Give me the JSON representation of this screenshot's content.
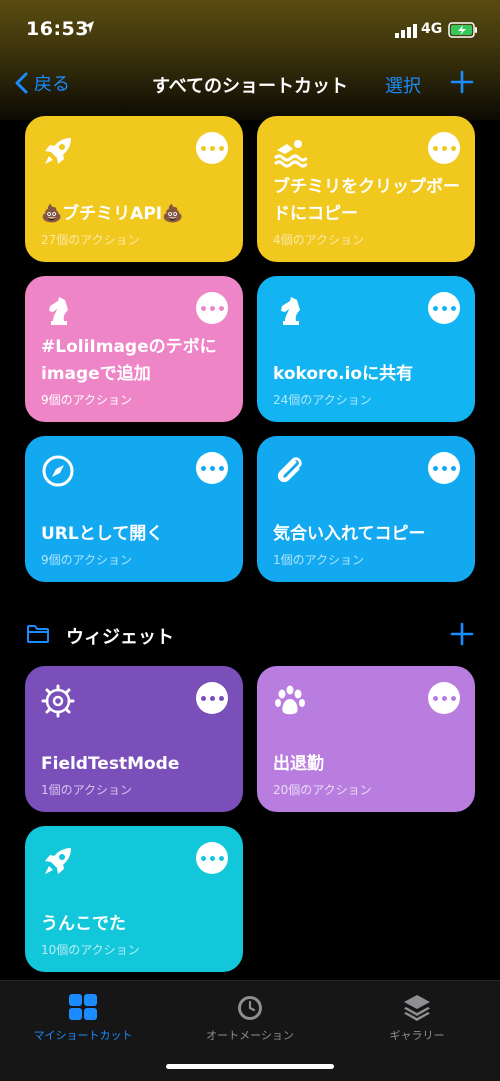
{
  "status_bar": {
    "time": "16:53",
    "network": "4G"
  },
  "nav": {
    "back_label": "戻る",
    "title": "すべてのショートカット",
    "select_label": "選択"
  },
  "cards": [
    {
      "title": "💩ブチミリAPI💩",
      "count": "27個のアクション",
      "color": "#f0c81e",
      "icon": "rocket-icon"
    },
    {
      "title": "ブチミリをクリップボードにコピー",
      "count": "4個のアクション",
      "color": "#f0c81e",
      "icon": "swimmer-icon"
    },
    {
      "title": "#LoliImageのテボにimageで追加",
      "count": "9個のアクション",
      "color": "#ee85c7",
      "icon": "chess-knight-icon"
    },
    {
      "title": "kokoro.ioに共有",
      "count": "24個のアクション",
      "color": "#12b5f2",
      "icon": "chess-knight-icon"
    },
    {
      "title": "URLとして開く",
      "count": "9個のアクション",
      "color": "#12a9f0",
      "icon": "compass-icon"
    },
    {
      "title": "気合い入れてコピー",
      "count": "1個のアクション",
      "color": "#12a9f0",
      "icon": "paperclip-icon"
    }
  ],
  "section": {
    "title": "ウィジェット",
    "icon": "folder-icon"
  },
  "widget_cards": [
    {
      "title": "FieldTestMode",
      "count": "1個のアクション",
      "color": "#7a4fb9",
      "icon": "gear-icon"
    },
    {
      "title": "出退勤",
      "count": "20個のアクション",
      "color": "#b87ddf",
      "icon": "paw-icon"
    },
    {
      "title": "うんこでた",
      "count": "10個のアクション",
      "color": "#13c7db",
      "icon": "rocket-icon"
    }
  ],
  "tabs": [
    {
      "label": "マイショートカット",
      "icon": "grid-icon",
      "active": true
    },
    {
      "label": "オートメーション",
      "icon": "clock-icon",
      "active": false
    },
    {
      "label": "ギャラリー",
      "icon": "layers-icon",
      "active": false
    }
  ],
  "colors": {
    "accent": "#1a8cff",
    "yellow": "#f0c81e",
    "pink": "#ee85c7",
    "blue": "#12a9f0",
    "purple_dark": "#7a4fb9",
    "purple_light": "#b87ddf",
    "cyan": "#13c7db"
  }
}
